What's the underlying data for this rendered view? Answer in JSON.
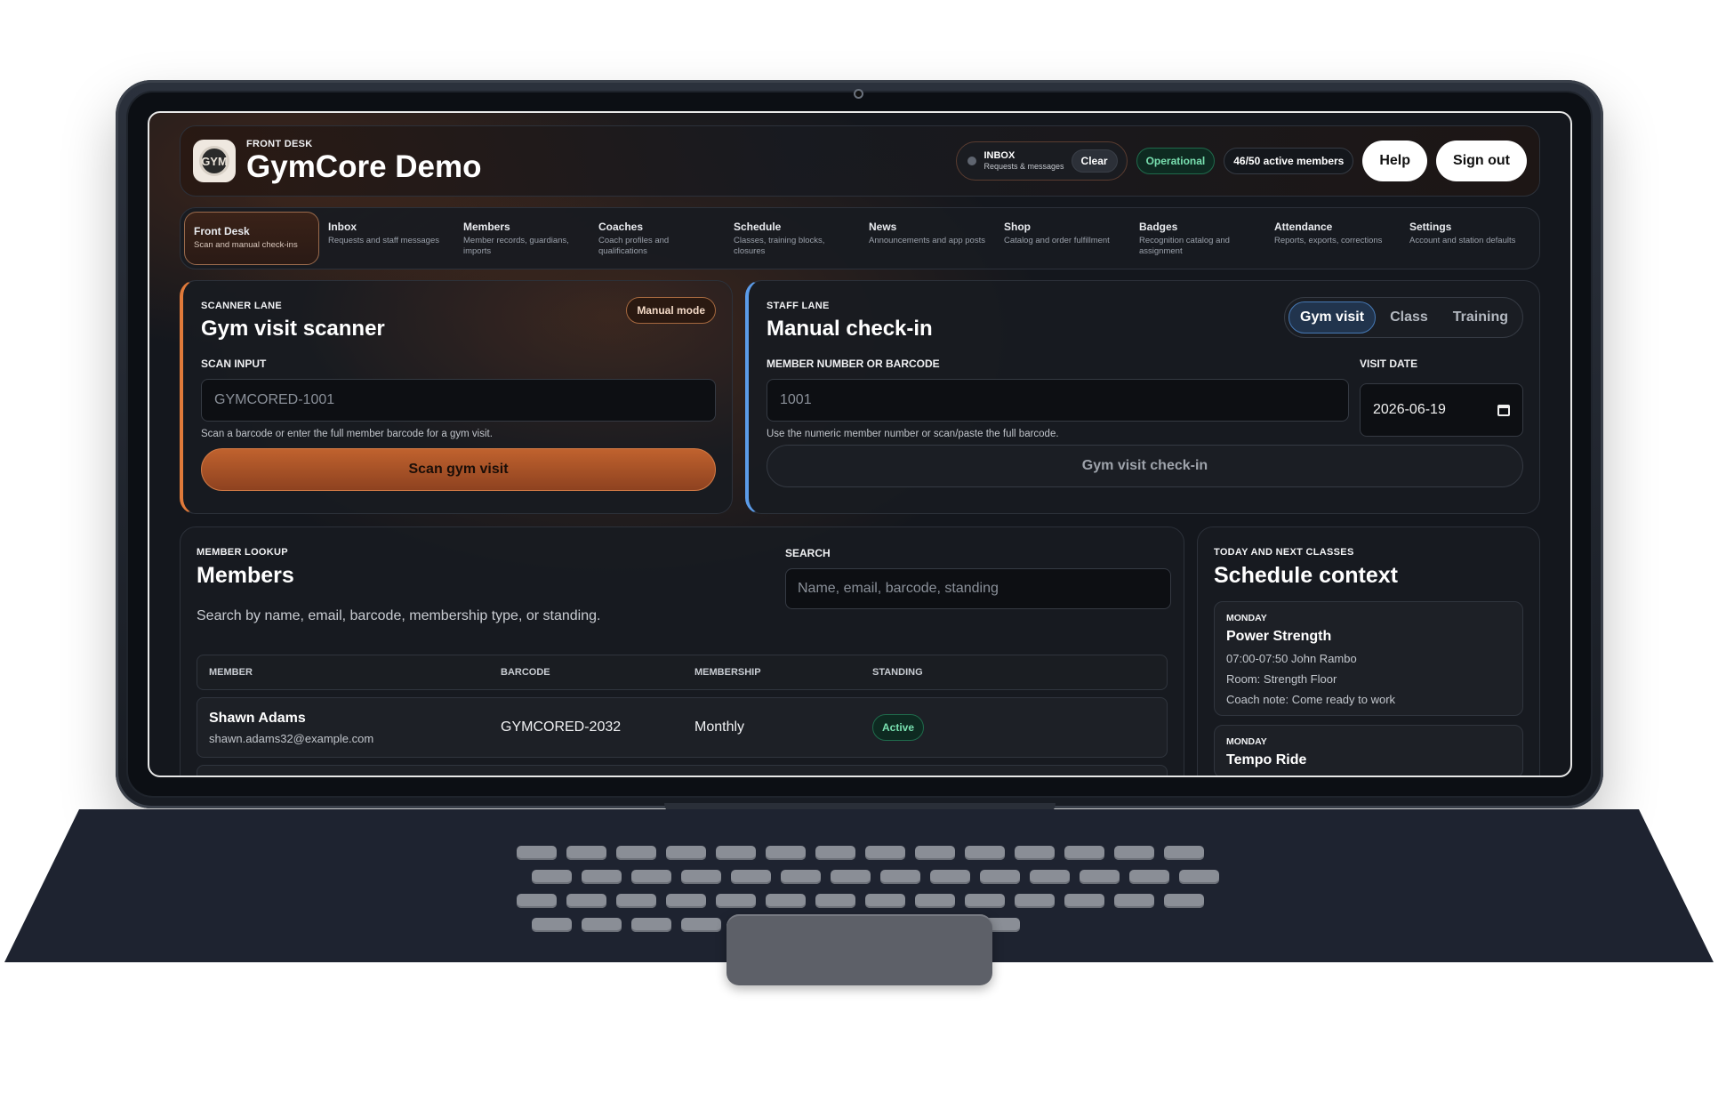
{
  "header": {
    "eyebrow": "FRONT DESK",
    "title": "GymCore Demo",
    "logo_text": "GYM",
    "inbox": {
      "label": "INBOX",
      "sub": "Requests & messages",
      "clear": "Clear"
    },
    "status": "Operational",
    "active_members": "46/50 active members",
    "help": "Help",
    "sign_out": "Sign out"
  },
  "nav": [
    {
      "label": "Front Desk",
      "sub": "Scan and manual check-ins"
    },
    {
      "label": "Inbox",
      "sub": "Requests and staff messages"
    },
    {
      "label": "Members",
      "sub": "Member records, guardians, imports"
    },
    {
      "label": "Coaches",
      "sub": "Coach profiles and qualifications"
    },
    {
      "label": "Schedule",
      "sub": "Classes, training blocks, closures"
    },
    {
      "label": "News",
      "sub": "Announcements and app posts"
    },
    {
      "label": "Shop",
      "sub": "Catalog and order fulfillment"
    },
    {
      "label": "Badges",
      "sub": "Recognition catalog and assignment"
    },
    {
      "label": "Attendance",
      "sub": "Reports, exports, corrections"
    },
    {
      "label": "Settings",
      "sub": "Account and station defaults"
    }
  ],
  "scanner": {
    "eyebrow": "SCANNER LANE",
    "title": "Gym visit scanner",
    "mode": "Manual mode",
    "input_label": "SCAN INPUT",
    "placeholder": "GYMCORED-1001",
    "helper": "Scan a barcode or enter the full member barcode for a gym visit.",
    "button": "Scan gym visit"
  },
  "manual": {
    "eyebrow": "STAFF LANE",
    "title": "Manual check-in",
    "tabs": [
      "Gym visit",
      "Class",
      "Training"
    ],
    "input_label": "MEMBER NUMBER OR BARCODE",
    "placeholder": "1001",
    "date_label": "VISIT DATE",
    "date_value": "2026-06-19",
    "helper": "Use the numeric member number or scan/paste the full barcode.",
    "button": "Gym visit check-in"
  },
  "members": {
    "eyebrow": "MEMBER LOOKUP",
    "title": "Members",
    "description": "Search by name, email, barcode, membership type, or standing.",
    "search_label": "SEARCH",
    "search_placeholder": "Name, email, barcode, standing",
    "columns": [
      "MEMBER",
      "BARCODE",
      "MEMBERSHIP",
      "STANDING"
    ],
    "rows": [
      {
        "name": "Shawn Adams",
        "email": "shawn.adams32@example.com",
        "barcode": "GYMCORED-2032",
        "membership": "Monthly",
        "standing": "Active"
      }
    ]
  },
  "schedule": {
    "eyebrow": "TODAY AND NEXT CLASSES",
    "title": "Schedule context",
    "classes": [
      {
        "day": "MONDAY",
        "name": "Power Strength",
        "time": "07:00-07:50 John Rambo",
        "room": "Room: Strength Floor",
        "note": "Coach note: Come ready to work"
      },
      {
        "day": "MONDAY",
        "name": "Tempo Ride"
      }
    ]
  },
  "colors": {
    "accent_orange": "#c0622e",
    "accent_blue": "#5b9be8",
    "success": "#79e0b0",
    "background": "#14171d"
  }
}
